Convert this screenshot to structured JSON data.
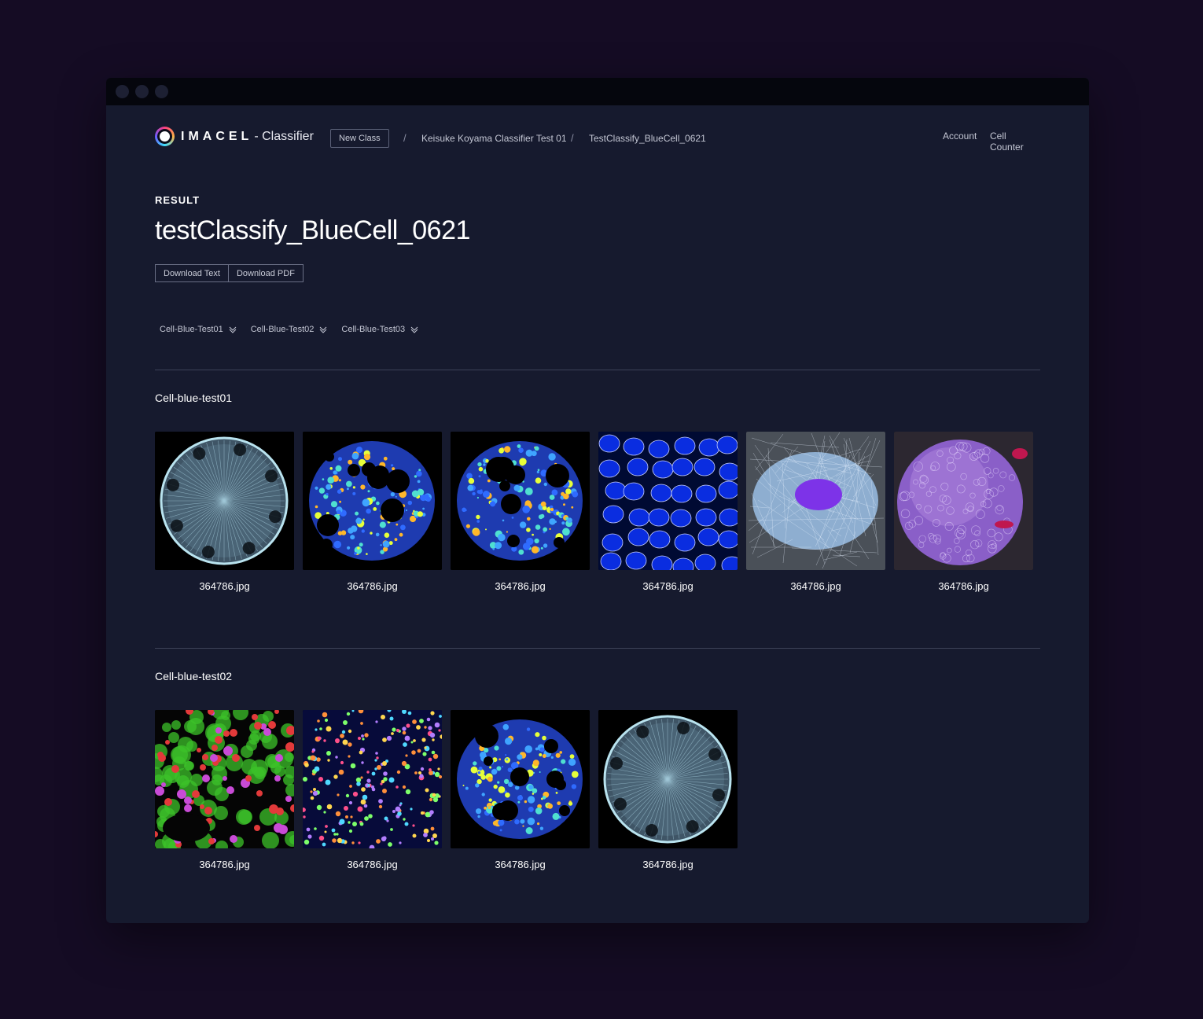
{
  "app": {
    "brand": "IMACEL",
    "product": "- Classifier"
  },
  "nav": {
    "new_class": "New Class",
    "crumbs": [
      "Keisuke Koyama Classifier Test 01",
      "TestClassify_BlueCell_0621"
    ],
    "separator": "/",
    "account": "Account",
    "cell_counter": "Cell Counter"
  },
  "result": {
    "label": "RESULT",
    "title": "testClassify_BlueCell_0621",
    "download_text": "Download Text",
    "download_pdf": "Download PDF"
  },
  "filters": [
    "Cell-Blue-Test01",
    "Cell-Blue-Test02",
    "Cell-Blue-Test03"
  ],
  "sections": [
    {
      "title": "Cell-blue-test01",
      "images": [
        {
          "file": "364786.jpg",
          "kind": "diatom"
        },
        {
          "file": "364786.jpg",
          "kind": "heatmap"
        },
        {
          "file": "364786.jpg",
          "kind": "heatmap"
        },
        {
          "file": "364786.jpg",
          "kind": "nuclei"
        },
        {
          "file": "364786.jpg",
          "kind": "cytoskeleton"
        },
        {
          "file": "364786.jpg",
          "kind": "sphere"
        }
      ]
    },
    {
      "title": "Cell-blue-test02",
      "images": [
        {
          "file": "364786.jpg",
          "kind": "tissue"
        },
        {
          "file": "364786.jpg",
          "kind": "dots"
        },
        {
          "file": "364786.jpg",
          "kind": "heatmap"
        },
        {
          "file": "364786.jpg",
          "kind": "diatom"
        }
      ]
    }
  ],
  "colors": {
    "page_bg": "#150c24",
    "window_bg": "#161a2e",
    "titlebar_bg": "#05060d",
    "divider": "#3d4258"
  }
}
